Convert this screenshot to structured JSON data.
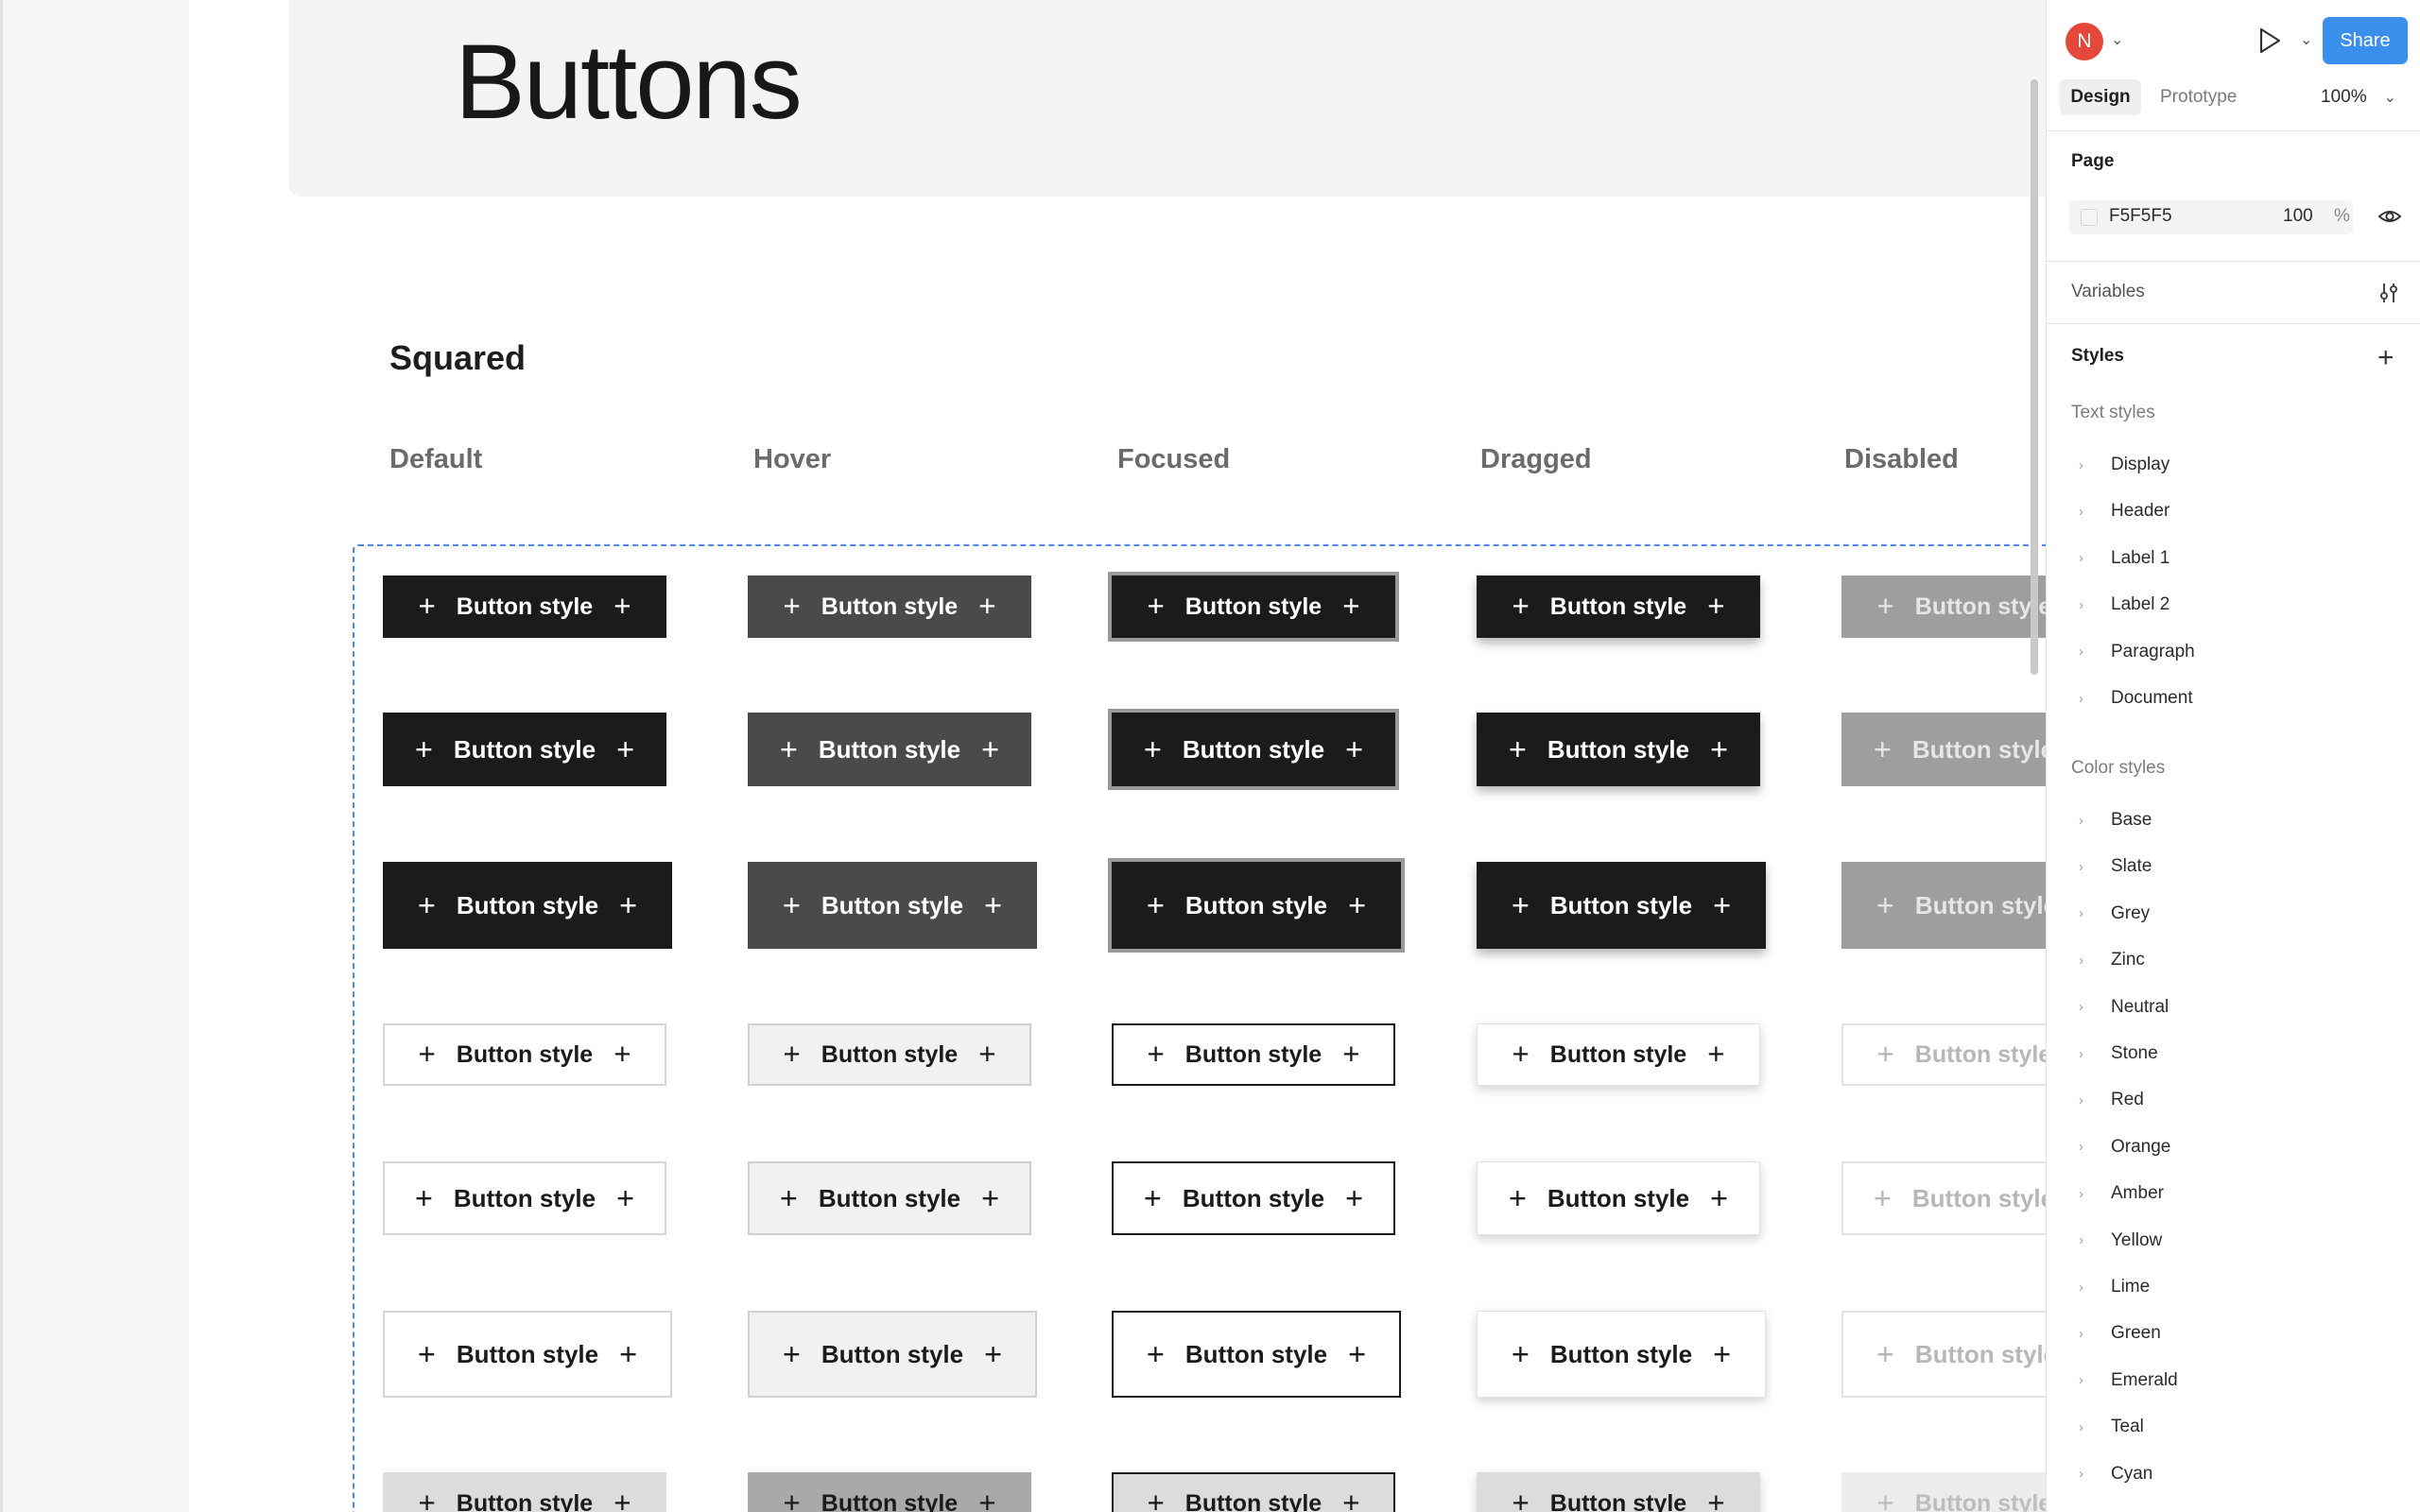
{
  "canvas": {
    "title": "Buttons",
    "section": "Squared",
    "columns": [
      "Default",
      "Hover",
      "Focused",
      "Dragged",
      "Disabled"
    ],
    "button_label": "Button style"
  },
  "panel": {
    "avatar_initial": "N",
    "share_label": "Share",
    "tabs": {
      "design": "Design",
      "prototype": "Prototype"
    },
    "zoom": "100%",
    "page": {
      "label": "Page",
      "fill_hex": "F5F5F5",
      "opacity": "100",
      "percent_sign": "%"
    },
    "variables_label": "Variables",
    "styles_label": "Styles",
    "text_styles": {
      "label": "Text styles",
      "items": [
        "Display",
        "Header",
        "Label 1",
        "Label 2",
        "Paragraph",
        "Document"
      ]
    },
    "color_styles": {
      "label": "Color styles",
      "items": [
        "Base",
        "Slate",
        "Grey",
        "Zinc",
        "Neutral",
        "Stone",
        "Red",
        "Orange",
        "Amber",
        "Yellow",
        "Lime",
        "Green",
        "Emerald",
        "Teal",
        "Cyan"
      ]
    }
  },
  "colors": {
    "accent": "#3b8fec",
    "avatar": "#e5473a",
    "selection": "#4f86e8",
    "button_dark": "#1b1b1b",
    "button_dark_hover": "#4a4a4a",
    "button_disabled": "#9e9e9e"
  },
  "icons": [
    "plus-icon",
    "play-icon",
    "chevron-down-icon",
    "eye-icon",
    "variables-icon",
    "chevron-right-icon"
  ]
}
